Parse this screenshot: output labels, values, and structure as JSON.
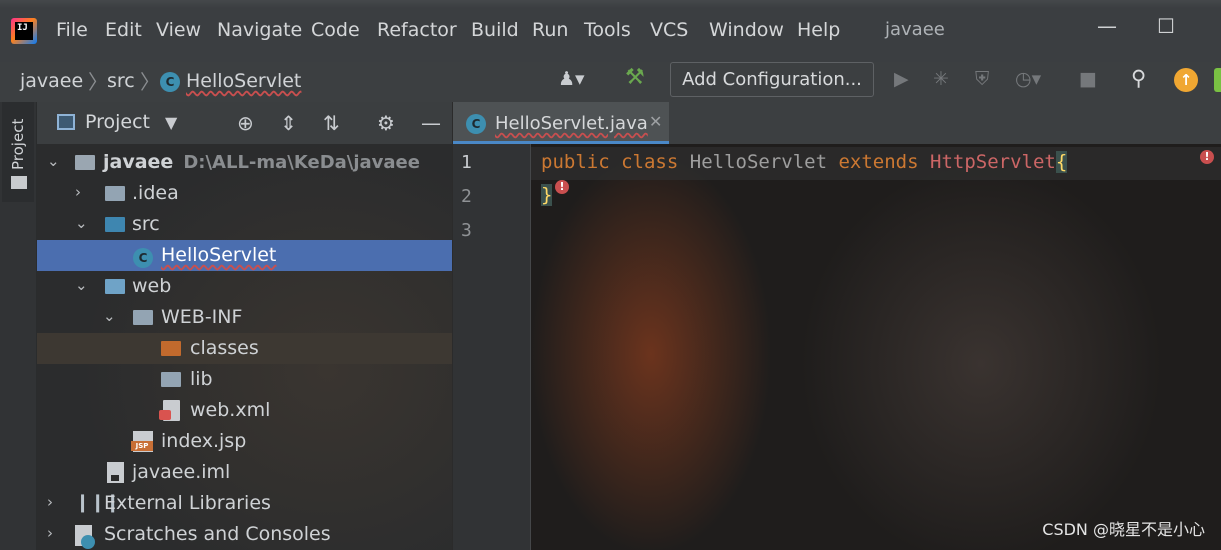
{
  "menu": {
    "items": [
      "File",
      "Edit",
      "View",
      "Navigate",
      "Code",
      "Refactor",
      "Build",
      "Run",
      "Tools",
      "VCS",
      "Window",
      "Help"
    ],
    "project_title": "javaee"
  },
  "window_controls": {
    "minimize": "—",
    "maximize": "☐"
  },
  "breadcrumb": [
    "javaee",
    "src",
    "HelloServlet"
  ],
  "toolbar": {
    "add_configuration": "Add Configuration..."
  },
  "project_panel": {
    "title": "Project",
    "stripe_label": "Project",
    "tree": [
      {
        "label": "javaee",
        "path": "D:\\ALL-ma\\KeDa\\javaee",
        "expanded": true,
        "icon": "module-folder-icon"
      },
      {
        "label": ".idea",
        "expanded": false,
        "icon": "folder-icon"
      },
      {
        "label": "src",
        "expanded": true,
        "icon": "source-folder-icon"
      },
      {
        "label": "HelloServlet",
        "icon": "class-icon",
        "selected": true
      },
      {
        "label": "web",
        "expanded": true,
        "icon": "web-folder-icon"
      },
      {
        "label": "WEB-INF",
        "expanded": true,
        "icon": "folder-icon"
      },
      {
        "label": "classes",
        "icon": "excluded-folder-icon",
        "highlighted": true
      },
      {
        "label": "lib",
        "icon": "folder-icon"
      },
      {
        "label": "web.xml",
        "icon": "xml-file-icon"
      },
      {
        "label": "index.jsp",
        "icon": "jsp-file-icon"
      },
      {
        "label": "javaee.iml",
        "icon": "iml-file-icon"
      },
      {
        "label": "External Libraries",
        "expanded": false,
        "icon": "libraries-icon"
      },
      {
        "label": "Scratches and Consoles",
        "expanded": false,
        "icon": "scratches-icon"
      }
    ]
  },
  "editor": {
    "tab_label": "HelloServlet.java",
    "line_numbers": [
      "1",
      "2",
      "3"
    ],
    "code": {
      "kw1": "public",
      "kw2": "class",
      "classname": "HelloServlet",
      "kw3": "extends",
      "superclass": "HttpServlet",
      "open_brace": "{",
      "close_brace": "}"
    }
  },
  "watermark": "CSDN @晓星不是小心"
}
